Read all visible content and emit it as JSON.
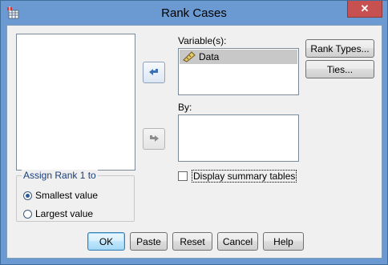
{
  "window": {
    "title": "Rank Cases",
    "close_symbol": "✕",
    "icon": "spss-table-icon"
  },
  "variables_label": "Variable(s):",
  "variables_items": [
    {
      "name": "Data",
      "icon": "scale-ruler-icon"
    }
  ],
  "by_label": "By:",
  "buttons": {
    "rank_types": "Rank Types...",
    "ties": "Ties...",
    "ok": "OK",
    "paste": "Paste",
    "reset": "Reset",
    "cancel": "Cancel",
    "help": "Help"
  },
  "assign_rank": {
    "legend": "Assign Rank 1 to",
    "options": [
      "Smallest value",
      "Largest value"
    ],
    "selected": "Smallest value"
  },
  "display_summary": {
    "label": "Display summary tables",
    "checked": false
  },
  "colors": {
    "titlebar": "#6b9ad2",
    "close_button": "#c75050",
    "arrow": "#3d6fb5",
    "client": "#f0f0f0"
  }
}
